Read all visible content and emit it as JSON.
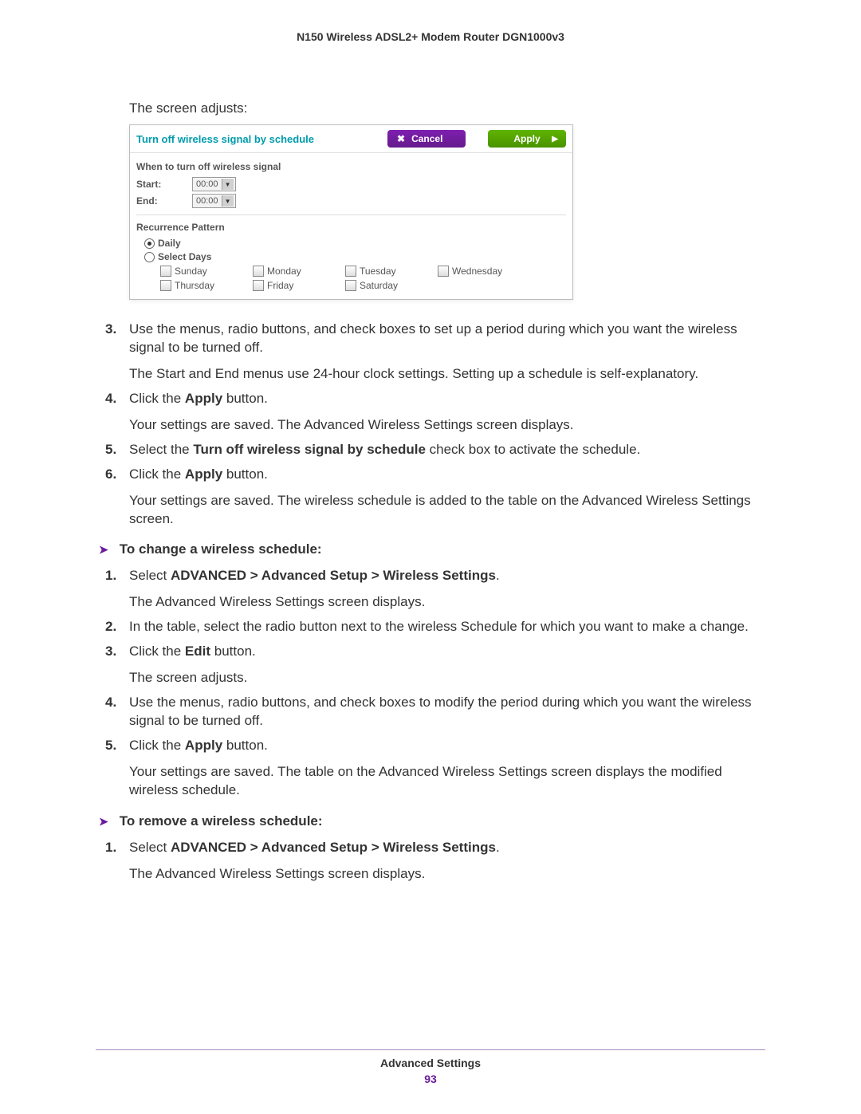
{
  "header": {
    "title": "N150 Wireless ADSL2+ Modem Router DGN1000v3"
  },
  "intro": "The screen adjusts:",
  "panel": {
    "title": "Turn off wireless signal by schedule",
    "cancel_label": "Cancel",
    "apply_label": "Apply",
    "section1": "When to turn off wireless signal",
    "start_label": "Start:",
    "start_value": "00:00",
    "end_label": "End:",
    "end_value": "00:00",
    "section2": "Recurrence Pattern",
    "daily_label": "Daily",
    "selectdays_label": "Select Days",
    "days": {
      "sun": "Sunday",
      "mon": "Monday",
      "tue": "Tuesday",
      "wed": "Wednesday",
      "thu": "Thursday",
      "fri": "Friday",
      "sat": "Saturday"
    }
  },
  "steps_a": {
    "s3": {
      "num": "3.",
      "text": "Use the menus, radio buttons, and check boxes to set up a period during which you want the wireless signal to be turned off.",
      "sub": "The Start and End menus use 24-hour clock settings. Setting up a schedule is self-explanatory."
    },
    "s4": {
      "num": "4.",
      "pre": "Click the ",
      "b": "Apply",
      "post": " button.",
      "sub": "Your settings are saved. The Advanced Wireless Settings screen displays."
    },
    "s5": {
      "num": "5.",
      "pre": "Select the ",
      "b": "Turn off wireless signal by schedule",
      "post": " check box to activate the schedule."
    },
    "s6": {
      "num": "6.",
      "pre": "Click the ",
      "b": "Apply",
      "post": " button.",
      "sub": "Your settings are saved. The wireless schedule is added to the table on the Advanced Wireless Settings screen."
    }
  },
  "heading_b": "To change a wireless schedule:",
  "steps_b": {
    "s1": {
      "num": "1.",
      "pre": "Select ",
      "b": "ADVANCED > Advanced Setup > Wireless Settings",
      "post": ".",
      "sub": "The Advanced Wireless Settings screen displays."
    },
    "s2": {
      "num": "2.",
      "text": "In the table, select the radio button next to the wireless Schedule for which you want to make a change."
    },
    "s3": {
      "num": "3.",
      "pre": "Click the ",
      "b": "Edit",
      "post": " button.",
      "sub": "The screen adjusts."
    },
    "s4": {
      "num": "4.",
      "text": "Use the menus, radio buttons, and check boxes to modify the period during which you want the wireless signal to be turned off."
    },
    "s5": {
      "num": "5.",
      "pre": "Click the ",
      "b": "Apply",
      "post": " button.",
      "sub": "Your settings are saved. The table on the Advanced Wireless Settings screen displays the modified wireless schedule."
    }
  },
  "heading_c": "To remove a wireless schedule:",
  "steps_c": {
    "s1": {
      "num": "1.",
      "pre": "Select ",
      "b": "ADVANCED > Advanced Setup > Wireless Settings",
      "post": ".",
      "sub": "The Advanced Wireless Settings screen displays."
    }
  },
  "footer": {
    "section": "Advanced Settings",
    "page": "93"
  }
}
